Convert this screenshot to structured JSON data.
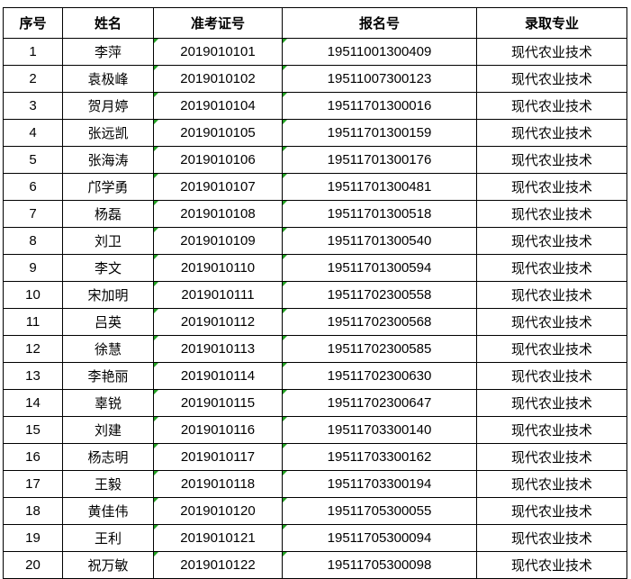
{
  "headers": [
    "序号",
    "姓名",
    "准考证号",
    "报名号",
    "录取专业"
  ],
  "rows": [
    {
      "no": "1",
      "name": "李萍",
      "exam_id": "2019010101",
      "reg_no": "19511001300409",
      "major": "现代农业技术"
    },
    {
      "no": "2",
      "name": "袁极峰",
      "exam_id": "2019010102",
      "reg_no": "19511007300123",
      "major": "现代农业技术"
    },
    {
      "no": "3",
      "name": "贺月婷",
      "exam_id": "2019010104",
      "reg_no": "19511701300016",
      "major": "现代农业技术"
    },
    {
      "no": "4",
      "name": "张远凯",
      "exam_id": "2019010105",
      "reg_no": "19511701300159",
      "major": "现代农业技术"
    },
    {
      "no": "5",
      "name": "张海涛",
      "exam_id": "2019010106",
      "reg_no": "19511701300176",
      "major": "现代农业技术"
    },
    {
      "no": "6",
      "name": "邝学勇",
      "exam_id": "2019010107",
      "reg_no": "19511701300481",
      "major": "现代农业技术"
    },
    {
      "no": "7",
      "name": "杨磊",
      "exam_id": "2019010108",
      "reg_no": "19511701300518",
      "major": "现代农业技术"
    },
    {
      "no": "8",
      "name": "刘卫",
      "exam_id": "2019010109",
      "reg_no": "19511701300540",
      "major": "现代农业技术"
    },
    {
      "no": "9",
      "name": "李文",
      "exam_id": "2019010110",
      "reg_no": "19511701300594",
      "major": "现代农业技术"
    },
    {
      "no": "10",
      "name": "宋加明",
      "exam_id": "2019010111",
      "reg_no": "19511702300558",
      "major": "现代农业技术"
    },
    {
      "no": "11",
      "name": "吕英",
      "exam_id": "2019010112",
      "reg_no": "19511702300568",
      "major": "现代农业技术"
    },
    {
      "no": "12",
      "name": "徐慧",
      "exam_id": "2019010113",
      "reg_no": "19511702300585",
      "major": "现代农业技术"
    },
    {
      "no": "13",
      "name": "李艳丽",
      "exam_id": "2019010114",
      "reg_no": "19511702300630",
      "major": "现代农业技术"
    },
    {
      "no": "14",
      "name": "辜锐",
      "exam_id": "2019010115",
      "reg_no": "19511702300647",
      "major": "现代农业技术"
    },
    {
      "no": "15",
      "name": "刘建",
      "exam_id": "2019010116",
      "reg_no": "19511703300140",
      "major": "现代农业技术"
    },
    {
      "no": "16",
      "name": "杨志明",
      "exam_id": "2019010117",
      "reg_no": "19511703300162",
      "major": "现代农业技术"
    },
    {
      "no": "17",
      "name": "王毅",
      "exam_id": "2019010118",
      "reg_no": "19511703300194",
      "major": "现代农业技术"
    },
    {
      "no": "18",
      "name": "黄佳伟",
      "exam_id": "2019010120",
      "reg_no": "19511705300055",
      "major": "现代农业技术"
    },
    {
      "no": "19",
      "name": "王利",
      "exam_id": "2019010121",
      "reg_no": "19511705300094",
      "major": "现代农业技术"
    },
    {
      "no": "20",
      "name": "祝万敏",
      "exam_id": "2019010122",
      "reg_no": "19511705300098",
      "major": "现代农业技术"
    }
  ],
  "colors": {
    "border": "#000000",
    "cell_flag": "#22a022",
    "background": "#ffffff"
  }
}
